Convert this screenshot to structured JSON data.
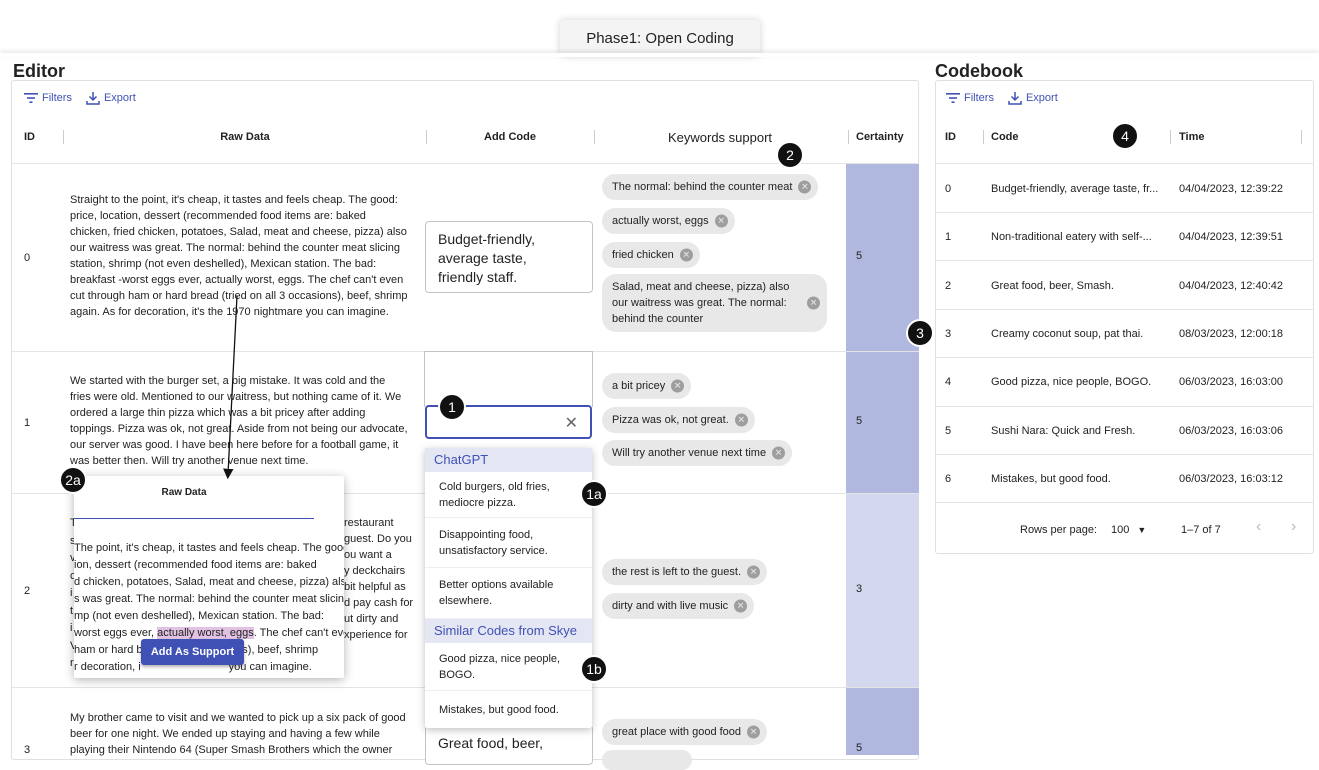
{
  "phase_tab": "Phase1: Open Coding",
  "editor": {
    "title": "Editor",
    "toolbar": {
      "filters": "Filters",
      "export": "Export"
    },
    "columns": {
      "id": "ID",
      "raw": "Raw Data",
      "add_code": "Add Code",
      "keywords": "Keywords support",
      "certainty": "Certainty"
    },
    "rows": [
      {
        "id": "0",
        "raw_lines": [
          "Straight to the point, it's cheap, it tastes and feels cheap. The good:",
          "price, location, dessert (recommended food items are: baked",
          "chicken, fried chicken, potatoes, Salad, meat and cheese, pizza) also",
          "our waitress was great. The normal: behind the counter meat slicing",
          "station, shrimp (not even deshelled), Mexican station. The bad:",
          "breakfast -worst eggs ever, actually worst, eggs. The chef can't even",
          "cut through ham or hard bread (tried on all 3 occasions), beef, shrimp",
          "again. As for decoration, it's the 1970 nightmare you can imagine."
        ],
        "code_lines": [
          "Budget-friendly,",
          "average taste,",
          "friendly staff."
        ],
        "keywords": [
          "The normal: behind the counter meat",
          "actually worst, eggs",
          "fried chicken",
          "Salad, meat and cheese, pizza) also our waitress was great. The normal: behind the counter"
        ],
        "certainty": "5"
      },
      {
        "id": "1",
        "raw_lines": [
          "We started with the burger set, a big mistake. It was cold and the",
          "fries were old. Mentioned to our waitress, but nothing came of it. We",
          "ordered a large thin pizza which was a bit pricey after adding",
          "toppings. Pizza was ok, not great. Aside from not being our advocate,",
          "our server was good. I have been here before for a football game, it",
          "was better then. Will try another venue next time."
        ],
        "keywords": [
          "a bit pricey",
          "Pizza was ok, not great.",
          "Will try another venue next time"
        ],
        "certainty": "5"
      },
      {
        "id": "2",
        "raw_right_lines": [
          "restaurant",
          "guest. Do you",
          "ou want a",
          "y deckchairs",
          "bit helpful as",
          "d pay cash for",
          "ut dirty and",
          "xperience for"
        ],
        "keywords": [
          "the rest is left to the guest.",
          "dirty and with live music"
        ],
        "certainty": "3"
      },
      {
        "id": "3",
        "raw_lines": [
          "My brother came to visit and we wanted to pick up a six pack of good",
          "beer for one night. We ended up staying and having a few while",
          "playing their Nintendo 64 (Super Smash Brothers which the owner"
        ],
        "code_lines": [
          "Great food, beer,"
        ],
        "keywords": [
          "great place with good food"
        ],
        "certainty": "5"
      }
    ],
    "dropdown": {
      "chatgpt_header": "ChatGPT",
      "chatgpt_items": [
        "Cold burgers, old fries, mediocre pizza.",
        "Disappointing food, unsatisfactory service.",
        "Better options available elsewhere."
      ],
      "skye_header": "Similar Codes from Skye",
      "skye_items": [
        "Good pizza, nice people, BOGO.",
        "Mistakes, but good food."
      ]
    },
    "popup": {
      "title": "Raw Data",
      "lines": [
        "The point, it's cheap, it tastes and feels cheap. The good:",
        "ion, dessert (recommended food items are: baked",
        "d chicken, potatoes, Salad, meat and cheese, pizza) also",
        "s was great. The normal: behind the counter meat slicing",
        "mp (not even deshelled), Mexican station. The bad:",
        "worst eggs ever, ",
        "ham or hard b",
        "r decoration, i"
      ],
      "highlight": "actually worst, eggs",
      "line6_tail": ". The chef can't even",
      "line7_tail": "casions), beef, shrimp",
      "line8_tail": "you can imagine.",
      "left_fragments": [
        "T",
        "s",
        "v",
        "c",
        "i",
        "t",
        "i",
        "V",
        "r"
      ],
      "button": "Add As Support"
    }
  },
  "codebook": {
    "title": "Codebook",
    "toolbar": {
      "filters": "Filters",
      "export": "Export"
    },
    "columns": {
      "id": "ID",
      "code": "Code",
      "time": "Time"
    },
    "rows": [
      {
        "id": "0",
        "code": "Budget-friendly, average taste, fr...",
        "time": "04/04/2023, 12:39:22"
      },
      {
        "id": "1",
        "code": "Non-traditional eatery with self-...",
        "time": "04/04/2023, 12:39:51"
      },
      {
        "id": "2",
        "code": "Great food, beer, Smash.",
        "time": "04/04/2023, 12:40:42"
      },
      {
        "id": "3",
        "code": "Creamy coconut soup, pat thai.",
        "time": "08/03/2023, 12:00:18"
      },
      {
        "id": "4",
        "code": "Good pizza, nice people, BOGO.",
        "time": "06/03/2023, 16:03:00"
      },
      {
        "id": "5",
        "code": "Sushi Nara: Quick and Fresh.",
        "time": "06/03/2023, 16:03:06"
      },
      {
        "id": "6",
        "code": "Mistakes, but good food.",
        "time": "06/03/2023, 16:03:12"
      }
    ],
    "pagination": {
      "rows_per_page_label": "Rows per page:",
      "rows_per_page_value": "100",
      "range": "1–7 of 7"
    }
  },
  "badges": {
    "b1": "1",
    "b1a": "1a",
    "b1b": "1b",
    "b2": "2",
    "b2a": "2a",
    "b3": "3",
    "b4": "4"
  },
  "colors": {
    "accent": "#3f51b5",
    "certainty_high": "#b0b8e0",
    "certainty_mid": "#d4d8ef",
    "highlight": "#e1c2e3"
  }
}
